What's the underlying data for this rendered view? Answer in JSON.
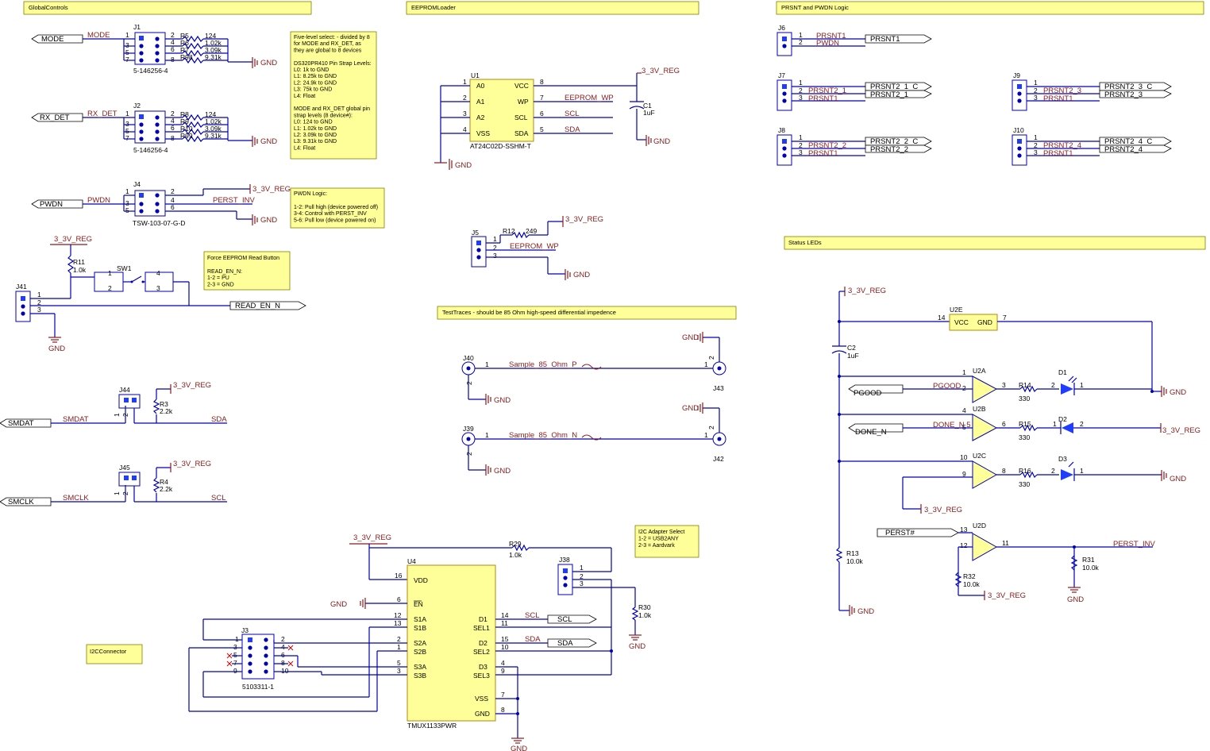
{
  "sections": {
    "global_controls": "GlobalControls",
    "eeprom_loader": "EEPROMLoader",
    "prsnt_logic": "PRSNT and PWDN Logic",
    "status_leds": "Status LEDs",
    "test_traces": "TestTraces - should be 85 Ohm high-speed differential impedence",
    "i2c_connector": "I2CConnector"
  },
  "notes": {
    "five_level": [
      "Five-level select: - divided by 8",
      "for MODE and RX_DET, as",
      "they are global to 8 devices",
      "",
      "DS320PR410 Pin Strap Levels:",
      "L0: 1k to GND",
      "L1: 8.25k to GND",
      "L2: 24.9k to GND",
      "L3: 75k to GND",
      "L4: Float",
      "",
      "MODE and RX_DET global pin",
      "strap levels (8 device#):",
      "L0: 124 to GND",
      "L1: 1.02k to GND",
      "L2: 3.09k to GND",
      "L3: 9.31k to GND",
      "L4: Float"
    ],
    "pwdn_logic": [
      "PWDN Logic:",
      "",
      "1-2: Pull high (device powered off)",
      "3-4: Control with PERST_INV",
      "5-6: Pull low (device powered on)"
    ],
    "force_eeprom": [
      "Force EEPROM Read Button",
      "",
      "READ_EN_N:",
      "1-2 = PU",
      "2-3 = GND"
    ],
    "i2c_adapter": [
      "I2C Adapter Select",
      "1-2 = USB2ANY",
      "2-3 = Aardvark"
    ]
  },
  "ports": {
    "mode": "MODE",
    "rx_det": "RX_DET",
    "pwdn": "PWDN",
    "read_en_n": "READ_EN_N",
    "smdat": "SMDAT",
    "smclk": "SMCLK",
    "scl": "SCL",
    "sda": "SDA",
    "prsnt1": "PRSNT1",
    "prsnt2_1_c": "PRSNT2_1_C",
    "prsnt2_1": "PRSNT2_1",
    "prsnt2_3_c": "PRSNT2_3_C",
    "prsnt2_3": "PRSNT2_3",
    "prsnt2_2_c": "PRSNT2_2_C",
    "prsnt2_2": "PRSNT2_2",
    "prsnt2_4_c": "PRSNT2_4_C",
    "prsnt2_4": "PRSNT2_4",
    "pgood": "PGOOD",
    "done_n": "DONE_N",
    "perst": "PERST#"
  },
  "nets": {
    "mode": "MODE",
    "rx_det": "RX_DET",
    "pwdn": "PWDN",
    "perst_inv": "PERST_INV",
    "v33": "3_3V_REG",
    "gnd": "GND",
    "smdat": "SMDAT",
    "smclk": "SMCLK",
    "sda": "SDA",
    "scl": "SCL",
    "eeprom_wp": "EEPROM_WP",
    "prsnt1": "PRSNT1",
    "prsnt2_1": "PRSNT2_1",
    "prsnt2_2": "PRSNT2_2",
    "prsnt2_3": "PRSNT2_3",
    "prsnt2_4": "PRSNT2_4",
    "pgood": "PGOOD",
    "done_n5": "DONE_N 5",
    "sample_p": "Sample_85_Ohm_P",
    "sample_n": "Sample_85_Ohm_N"
  },
  "refs": {
    "j1": "J1",
    "j1_part": "5-146256-4",
    "j2": "J2",
    "j2_part": "5-146256-4",
    "j4": "J4",
    "j4_part": "TSW-103-07-G-D",
    "j41": "J41",
    "sw1": "SW1",
    "j44": "J44",
    "j45": "J45",
    "r3": "R3",
    "r3_val": "2.2k",
    "r4": "R4",
    "r4_val": "2.2k",
    "r11": "R11",
    "r11_val": "1.0k",
    "r5": "R5",
    "r5_val": "124",
    "r6": "R6",
    "r6_val": "1.02k",
    "r7": "R7",
    "r7_val": "3.09k",
    "r98": "R98",
    "r98_val": "9.31k",
    "r8": "R8",
    "r8_val": "124",
    "r9": "R9",
    "r9_val": "1.02k",
    "r10": "R10",
    "r10_val": "3.09k",
    "r99": "R99",
    "r99_val": "9.31k",
    "u1": "U1",
    "u1_part": "AT24C02D-SSHM-T",
    "c1": "C1",
    "c1_val": "1uF",
    "j5": "J5",
    "r12": "R12",
    "r12_val": "249",
    "j40": "J40",
    "j43": "J43",
    "j39": "J39",
    "j42": "J42",
    "j6": "J6",
    "j7": "J7",
    "j8": "J8",
    "j9": "J9",
    "j10": "J10",
    "u2e": "U2E",
    "c2": "C2",
    "c2_val": "1uF",
    "u2a": "U2A",
    "u2b": "U2B",
    "u2c": "U2C",
    "u2d": "U2D",
    "r14": "R14",
    "r14_val": "330",
    "r15": "R15",
    "r15_val": "330",
    "r16": "R16",
    "r16_val": "330",
    "d1": "D1",
    "d2": "D2",
    "d3": "D3",
    "r13": "R13",
    "r13_val": "10.0k",
    "r31": "R31",
    "r31_val": "10.0k",
    "r32": "R32",
    "r32_val": "10.0k",
    "u4": "U4",
    "u4_part": "TMUX1133PWR",
    "j3": "J3",
    "j3_part": "5103311-1",
    "r29": "R29",
    "r29_val": "1.0k",
    "r30": "R30",
    "r30_val": "1.0k",
    "j38": "J38"
  },
  "u1_pins": {
    "a0": "A0",
    "a1": "A1",
    "a2": "A2",
    "vss": "VSS",
    "vcc": "VCC",
    "wp": "WP",
    "scl": "SCL",
    "sda": "SDA"
  },
  "u4_pins": {
    "vdd": "VDD",
    "en": "EN",
    "s1a": "S1A",
    "s1b": "S1B",
    "s2a": "S2A",
    "s2b": "S2B",
    "s3a": "S3A",
    "s3b": "S3B",
    "d1": "D1",
    "sel1": "SEL1",
    "d2": "D2",
    "sel2": "SEL2",
    "d3": "D3",
    "sel3": "SEL3",
    "vss": "VSS",
    "gnd": "GND"
  },
  "u2e_pins": {
    "vcc": "VCC",
    "gnd": "GND"
  },
  "colors": {
    "wire": "#0000b4",
    "net": "#8b1a1a",
    "note": "#ffff99",
    "pad": "#1f3cff"
  }
}
